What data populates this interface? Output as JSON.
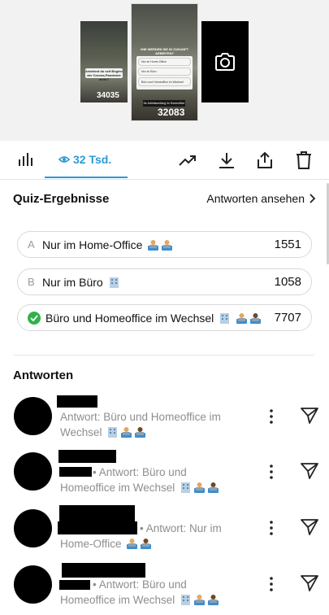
{
  "preview": {
    "stories": [
      {
        "caption": "Arbeitest du seit Beginn der Corona-Pandemie mehr?",
        "count": "34035"
      },
      {
        "caption": "WIE WERDEN SIE IN ZUKUNFT ARBEITEN?",
        "count": "32083",
        "options": [
          "Nur im Home-Office",
          "Nur im Büro",
          "Büro und Homeoffice im Wechsel"
        ],
        "footer": "Ihr Arbeitsumfang im Homeoffice"
      },
      {
        "caption": "",
        "count": ""
      }
    ]
  },
  "tabs": {
    "views_label": "32 Tsd."
  },
  "quiz": {
    "title": "Quiz-Ergebnisse",
    "view_answers": "Antworten ansehen",
    "results": [
      {
        "letter": "A",
        "label": "Nur im Home-Office",
        "count": "1551",
        "correct": false,
        "emoji": [
          "worker",
          "worker"
        ]
      },
      {
        "letter": "B",
        "label": "Nur im Büro",
        "count": "1058",
        "correct": false,
        "emoji": [
          "office"
        ]
      },
      {
        "letter": "",
        "label": "Büro und Homeoffice im Wechsel",
        "count": "7707",
        "correct": true,
        "emoji": [
          "office",
          "worker",
          "worker"
        ]
      }
    ]
  },
  "answers": {
    "title": "Antworten",
    "items": [
      {
        "line1": "Antwort: Büro und Homeoffice im",
        "line2": "Wechsel"
      },
      {
        "line1": "• Antwort: Büro und",
        "line2": "Homeoffice im Wechsel"
      },
      {
        "line1": "• Antwort: Nur im",
        "line2": "Home-Office"
      },
      {
        "line1": "• Antwort: Büro und",
        "line2": "Homeoffice im Wechsel"
      }
    ]
  },
  "colors": {
    "accent": "#2b9bd6",
    "correct": "#2fb34a"
  }
}
